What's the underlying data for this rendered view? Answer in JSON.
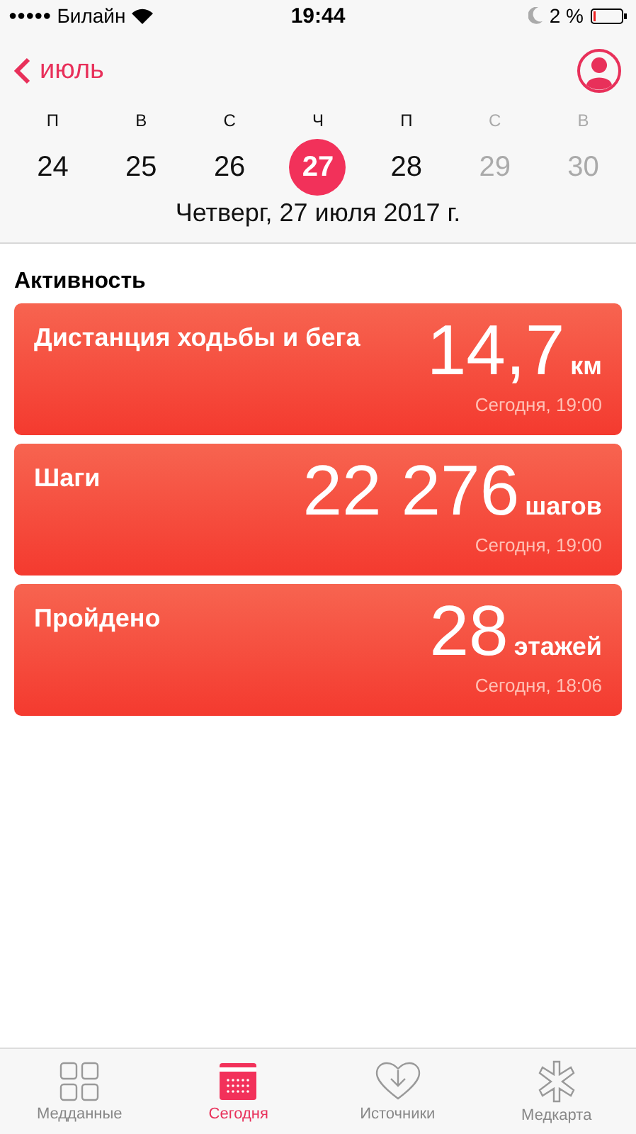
{
  "status_bar": {
    "signal_dots": "●●●●●",
    "carrier": "Билайн",
    "time": "19:44",
    "battery": "2 %"
  },
  "nav": {
    "back": "июль"
  },
  "week": [
    {
      "letter": "П",
      "day": "24",
      "selected": false,
      "dimmed": false
    },
    {
      "letter": "В",
      "day": "25",
      "selected": false,
      "dimmed": false
    },
    {
      "letter": "С",
      "day": "26",
      "selected": false,
      "dimmed": false
    },
    {
      "letter": "Ч",
      "day": "27",
      "selected": true,
      "dimmed": false
    },
    {
      "letter": "П",
      "day": "28",
      "selected": false,
      "dimmed": false
    },
    {
      "letter": "С",
      "day": "29",
      "selected": false,
      "dimmed": true
    },
    {
      "letter": "В",
      "day": "30",
      "selected": false,
      "dimmed": true
    }
  ],
  "date_title": "Четверг, 27 июля 2017 г.",
  "section_title": "Активность",
  "cards": [
    {
      "title": "Дистанция ходьбы и бега",
      "value": "14,7",
      "unit": "км",
      "time": "Сегодня, 19:00"
    },
    {
      "title": "Шаги",
      "value": "22 276",
      "unit": "шагов",
      "time": "Сегодня, 19:00"
    },
    {
      "title": "Пройдено",
      "value": "28",
      "unit": "этажей",
      "time": "Сегодня, 18:06"
    }
  ],
  "tabs": [
    {
      "kind": "grid",
      "label": "Медданные",
      "selected": false
    },
    {
      "kind": "calendar",
      "label": "Сегодня",
      "selected": true
    },
    {
      "kind": "heart",
      "label": "Источники",
      "selected": false
    },
    {
      "kind": "star",
      "label": "Медкарта",
      "selected": false
    }
  ]
}
